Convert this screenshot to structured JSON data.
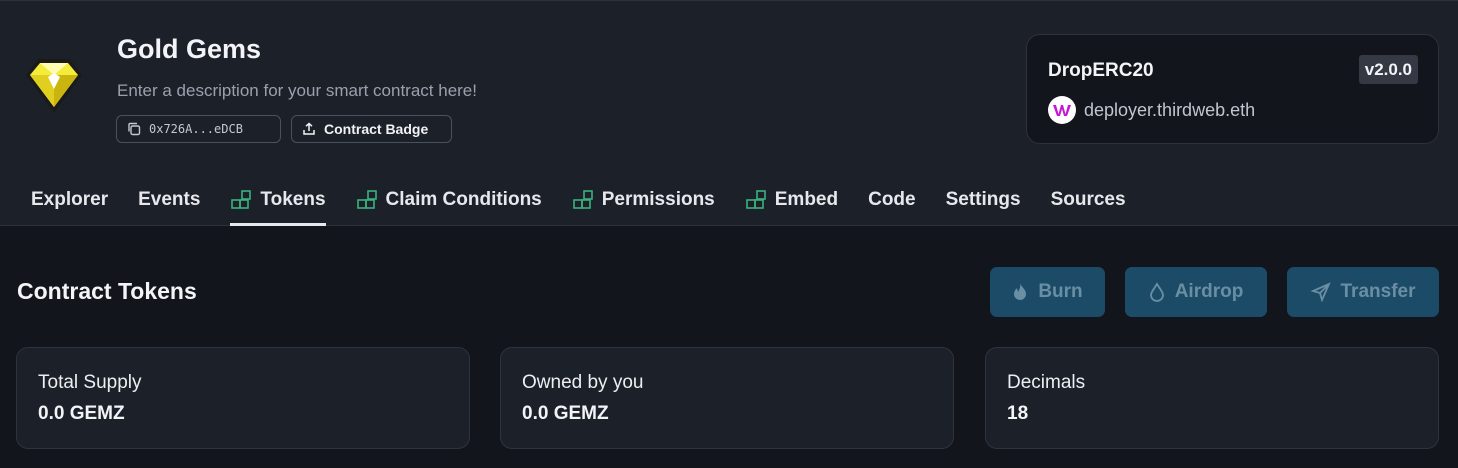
{
  "contract": {
    "name": "Gold Gems",
    "description": "Enter a description for your smart contract here!",
    "address": "0x726A...eDCB",
    "badge_label": "Contract Badge"
  },
  "deployment": {
    "name": "DropERC20",
    "version": "v2.0.0",
    "deployer": "deployer.thirdweb.eth"
  },
  "tabs": [
    {
      "label": "Explorer",
      "icon": false
    },
    {
      "label": "Events",
      "icon": false
    },
    {
      "label": "Tokens",
      "icon": true,
      "active": true
    },
    {
      "label": "Claim Conditions",
      "icon": true
    },
    {
      "label": "Permissions",
      "icon": true
    },
    {
      "label": "Embed",
      "icon": true
    },
    {
      "label": "Code",
      "icon": false
    },
    {
      "label": "Settings",
      "icon": false
    },
    {
      "label": "Sources",
      "icon": false
    }
  ],
  "section": {
    "title": "Contract Tokens",
    "actions": {
      "burn": "Burn",
      "airdrop": "Airdrop",
      "transfer": "Transfer"
    }
  },
  "stats": [
    {
      "label": "Total Supply",
      "value": "0.0 GEMZ"
    },
    {
      "label": "Owned by you",
      "value": "0.0 GEMZ"
    },
    {
      "label": "Decimals",
      "value": "18"
    }
  ],
  "colors": {
    "accent_icon": "#3bb27c",
    "button_bg": "#1b4b67",
    "button_text": "#6a8ea3"
  }
}
